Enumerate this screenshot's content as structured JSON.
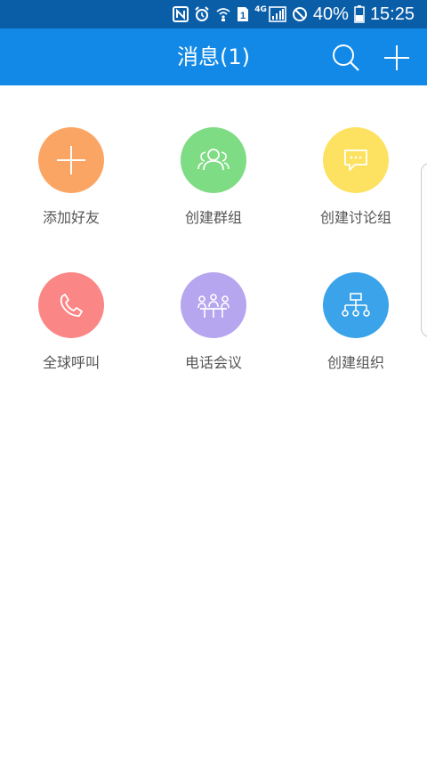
{
  "status_bar": {
    "battery": "40%",
    "time": "15:25",
    "network_label": "4G",
    "sim_number": "1"
  },
  "header": {
    "title": "消息(1)"
  },
  "actions": [
    {
      "label": "添加好友",
      "icon": "plus-icon",
      "color": "#fba564"
    },
    {
      "label": "创建群组",
      "icon": "group-icon",
      "color": "#7edc84"
    },
    {
      "label": "创建讨论组",
      "icon": "chat-bubble-icon",
      "color": "#fde262"
    },
    {
      "label": "全球呼叫",
      "icon": "phone-icon",
      "color": "#fb8686"
    },
    {
      "label": "电话会议",
      "icon": "conference-icon",
      "color": "#b6a6ef"
    },
    {
      "label": "创建组织",
      "icon": "org-chart-icon",
      "color": "#3aa3ea"
    }
  ],
  "colors": {
    "status_bar": "#0a5ea8",
    "app_bar": "#1289e6",
    "label_text": "#555555"
  }
}
